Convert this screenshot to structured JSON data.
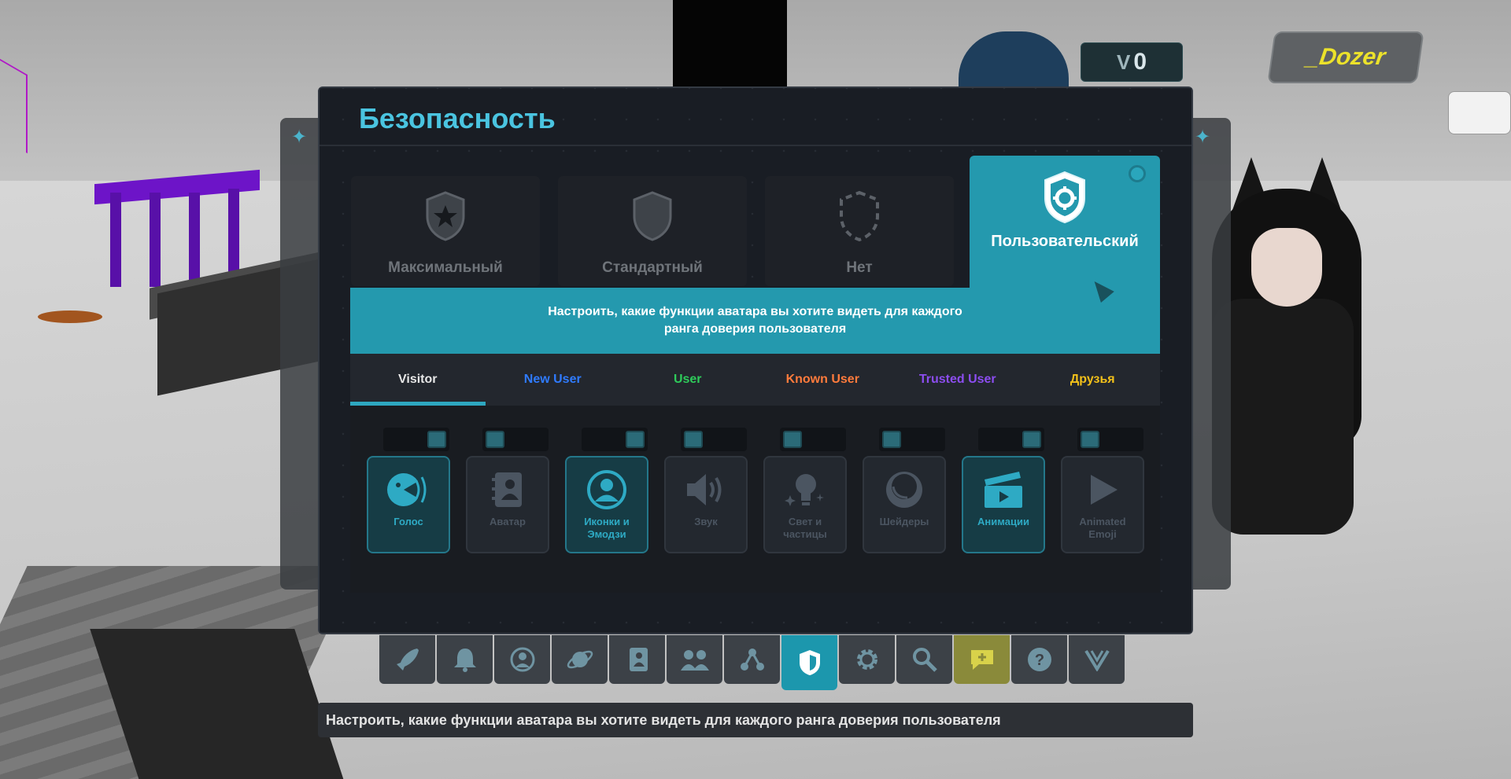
{
  "hud": {
    "credits_value": "0",
    "username": "_Dozer"
  },
  "panel": {
    "title": "Безопасность"
  },
  "presets": [
    {
      "label": "Максимальный",
      "icon": "shield-star-icon"
    },
    {
      "label": "Стандартный",
      "icon": "shield-icon"
    },
    {
      "label": "Нет",
      "icon": "shield-dashed-icon"
    },
    {
      "label": "Пользовательский",
      "icon": "shield-gear-icon",
      "selected": true
    }
  ],
  "description": "Настроить, какие функции аватара вы хотите видеть для каждого ранга доверия пользователя",
  "trust_tabs": [
    {
      "label": "Visitor",
      "color": "#e6e6e6",
      "active": true
    },
    {
      "label": "New User",
      "color": "#2f7bff"
    },
    {
      "label": "User",
      "color": "#2ecb5a"
    },
    {
      "label": "Known User",
      "color": "#ff7b3c"
    },
    {
      "label": "Trusted User",
      "color": "#8c4df0"
    },
    {
      "label": "Друзья",
      "color": "#f2c01a"
    }
  ],
  "features": [
    {
      "label": "Голос",
      "icon": "voice-icon",
      "enabled": true
    },
    {
      "label": "Аватар",
      "icon": "avatar-book-icon",
      "enabled": false
    },
    {
      "label": "Иконки и Эмодзи",
      "icon": "user-circle-icon",
      "enabled": true
    },
    {
      "label": "Звук",
      "icon": "speaker-icon",
      "enabled": false
    },
    {
      "label": "Свет и частицы",
      "icon": "lightbulb-icon",
      "enabled": false
    },
    {
      "label": "Шейдеры",
      "icon": "shader-sphere-icon",
      "enabled": false
    },
    {
      "label": "Анимации",
      "icon": "clapperboard-icon",
      "enabled": true
    },
    {
      "label": "Animated Emoji",
      "icon": "play-icon",
      "enabled": false
    }
  ],
  "dock": [
    {
      "name": "launch-icon",
      "active": false
    },
    {
      "name": "bell-icon",
      "active": false
    },
    {
      "name": "profile-icon",
      "active": false
    },
    {
      "name": "worlds-icon",
      "active": false
    },
    {
      "name": "avatars-icon",
      "active": false
    },
    {
      "name": "social-icon",
      "active": false
    },
    {
      "name": "groups-icon",
      "active": false
    },
    {
      "name": "safety-icon",
      "active": true
    },
    {
      "name": "settings-icon",
      "active": false
    },
    {
      "name": "search-icon",
      "active": false
    },
    {
      "name": "chat-add-icon",
      "active": false
    },
    {
      "name": "help-icon",
      "active": false
    },
    {
      "name": "vrchat-logo-icon",
      "active": false
    }
  ],
  "status_bar": "Настроить, какие функции аватара вы хотите видеть для каждого ранга доверия пользователя"
}
